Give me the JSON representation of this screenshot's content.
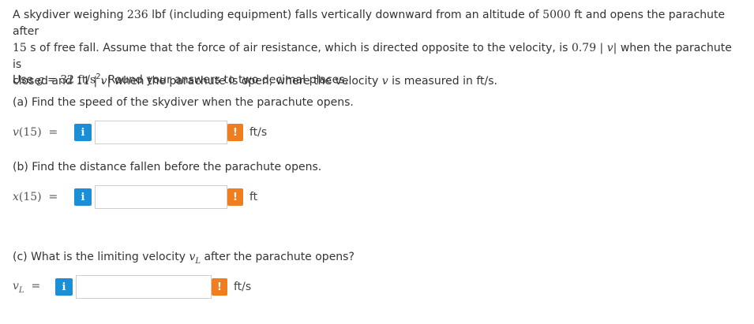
{
  "problem": {
    "p1": {
      "s1": "A skydiver weighing ",
      "weight": "236",
      "s2": " lbf (including equipment) falls vertically downward from an altitude of ",
      "altitude": "5000",
      "s3": " ft and opens the parachute after",
      "time": "15",
      "s4": " s of free fall. Assume that the force of air resistance, which is directed opposite to the velocity, is ",
      "k1": "0.79 | ",
      "v1": "v",
      "bar1": "|",
      "s5": " when the parachute is",
      "s6": "closed and ",
      "k2": "11 | ",
      "v2": "v",
      "bar2": "|",
      "s7": " when the parachute is open, where the velocity ",
      "v3": "v",
      "s8": " is measured in ft/s."
    },
    "p2": {
      "s1": "Use ",
      "g": "g",
      "eq": " = ",
      "val": "32 ft/s",
      "exp": "2",
      "s2": ". Round your answers to two decimal places."
    }
  },
  "parts": {
    "a": {
      "question": "(a) Find the speed of the skydiver when the parachute opens.",
      "label_fn": "v",
      "label_rest": "(15)  =",
      "value": "",
      "unit": "ft/s"
    },
    "b": {
      "question": "(b) Find the distance fallen before the parachute opens.",
      "label_fn": "x",
      "label_rest": "(15)  =",
      "value": "",
      "unit": "ft"
    },
    "c": {
      "q_before": "(c) What is the limiting velocity ",
      "q_var": "v",
      "q_sub": "L",
      "q_after": " after the parachute opens?",
      "label_var": "v",
      "label_sub": "L",
      "label_rest": "  =",
      "value": "",
      "unit": "ft/s"
    }
  },
  "icons": {
    "info_glyph": "i",
    "warn_glyph": "!"
  },
  "colors": {
    "info": "#1a8fd6",
    "warn": "#f07d1e"
  }
}
